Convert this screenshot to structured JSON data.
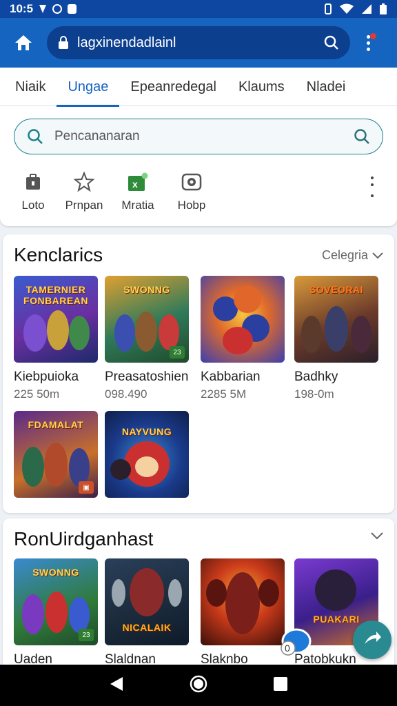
{
  "status_bar": {
    "time": "10:5"
  },
  "url_bar": {
    "text": "lagxinendadlainl"
  },
  "tabs": [
    {
      "label": "Niaik"
    },
    {
      "label": "Ungae"
    },
    {
      "label": "Epeanredegal"
    },
    {
      "label": "Klaums"
    },
    {
      "label": "Nladei"
    }
  ],
  "search": {
    "placeholder": "Pencananaran"
  },
  "categories": [
    {
      "label": "Loto",
      "icon": "bag-icon"
    },
    {
      "label": "Prnpan",
      "icon": "star-icon"
    },
    {
      "label": "Mratia",
      "icon": "spreadsheet-icon"
    },
    {
      "label": "Hobp",
      "icon": "camera-icon"
    }
  ],
  "section1": {
    "title": "Kenclarics",
    "filter": "Celegria",
    "games": [
      {
        "title_art": "TAMERNIER FONBAREAN",
        "name": "Kiebpuioka",
        "size": "225 50m"
      },
      {
        "title_art": "SWONNG",
        "name": "Preasatoshien",
        "size": "098.490"
      },
      {
        "title_art": "",
        "name": "Kabbarian",
        "size": "2285 5M"
      },
      {
        "title_art": "SOVEORAI",
        "name": "Badhky",
        "size": "198-0m"
      },
      {
        "title_art": "FDAMALAT",
        "name": "",
        "size": ""
      },
      {
        "title_art": "NAYVUNG",
        "name": "",
        "size": ""
      }
    ]
  },
  "section2": {
    "title": "RonUirdganhast",
    "games": [
      {
        "title_art": "SWONNG",
        "name": "Uaden"
      },
      {
        "title_art": "NICALAIK",
        "name": "Slaldnan"
      },
      {
        "title_art": "",
        "name": "Slaknbo"
      },
      {
        "title_art": "PUAKARI",
        "name": "Patobkukn"
      }
    ]
  },
  "colors": {
    "primary": "#1565c0",
    "status_bar": "#0d47a1",
    "accent_teal": "#2a8a92"
  }
}
